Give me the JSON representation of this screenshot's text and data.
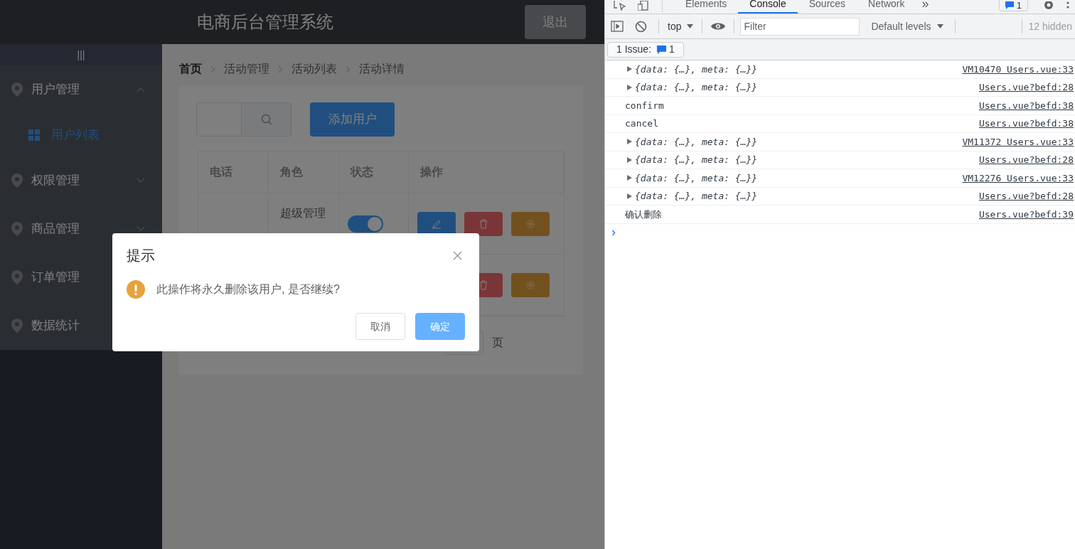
{
  "app": {
    "title": "电商后台管理系统",
    "logout": "退出",
    "sidebar": {
      "toggle": "|||",
      "items": [
        {
          "label": "用户管理",
          "expanded": true,
          "children": [
            {
              "label": "用户列表",
              "selected": true
            }
          ]
        },
        {
          "label": "权限管理",
          "expanded": false
        },
        {
          "label": "商品管理",
          "expanded": false
        },
        {
          "label": "订单管理"
        },
        {
          "label": "数据统计"
        }
      ]
    },
    "breadcrumb": [
      "首页",
      "活动管理",
      "活动列表",
      "活动详情"
    ],
    "add_button": "添加用户",
    "table": {
      "columns": [
        "电话",
        "角色",
        "状态",
        "操作"
      ],
      "rows": [
        {
          "kind": "full",
          "role": "超级管理",
          "on": true
        },
        {
          "kind": "covered"
        }
      ]
    },
    "pagination": {
      "suffix": "页"
    }
  },
  "dialog": {
    "title": "提示",
    "message": "此操作将永久删除该用户, 是否继续?",
    "buttons": [
      {
        "label": "取消",
        "kind": "default"
      },
      {
        "label": "确定",
        "kind": "primary"
      }
    ]
  },
  "devtools": {
    "tabs": [
      {
        "label": "Elements",
        "selected": false
      },
      {
        "label": "Console",
        "selected": true
      },
      {
        "label": "Sources",
        "selected": false
      },
      {
        "label": "Network",
        "selected": false
      }
    ],
    "more": "»",
    "issues_badge": "1",
    "context": "top",
    "filter_placeholder": "Filter",
    "levels": "Default levels",
    "hidden": "12 hidden",
    "issue_label": "1 Issue:",
    "issue_count": "1",
    "logs": [
      {
        "kind": "object",
        "text": "{data: {…}, meta: {…}}",
        "source": "VM10470 Users.vue:33"
      },
      {
        "kind": "object",
        "text": "{data: {…}, meta: {…}}",
        "source": "Users.vue?befd:28"
      },
      {
        "kind": "text",
        "text": "confirm",
        "source": "Users.vue?befd:38"
      },
      {
        "kind": "text",
        "text": "cancel",
        "source": "Users.vue?befd:38"
      },
      {
        "kind": "object",
        "text": "{data: {…}, meta: {…}}",
        "source": "VM11372 Users.vue:33"
      },
      {
        "kind": "object",
        "text": "{data: {…}, meta: {…}}",
        "source": "Users.vue?befd:28"
      },
      {
        "kind": "object",
        "text": "{data: {…}, meta: {…}}",
        "source": "VM12276 Users.vue:33"
      },
      {
        "kind": "object",
        "text": "{data: {…}, meta: {…}}",
        "source": "Users.vue?befd:28"
      },
      {
        "kind": "text",
        "text": "确认删除",
        "source": "Users.vue?befd:39"
      }
    ],
    "prompt": "›"
  }
}
